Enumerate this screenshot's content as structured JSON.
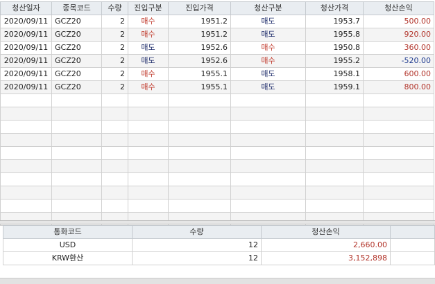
{
  "trades": {
    "headers": [
      "청산일자",
      "종목코드",
      "수량",
      "진입구분",
      "진입가격",
      "청산구분",
      "청산가격",
      "청산손익"
    ],
    "rows": [
      {
        "date": "2020/09/11",
        "code": "GCZ20",
        "qty": "2",
        "entry_side": "매수",
        "entry_price": "1951.2",
        "exit_side": "매도",
        "exit_price": "1953.7",
        "pnl": "500.00"
      },
      {
        "date": "2020/09/11",
        "code": "GCZ20",
        "qty": "2",
        "entry_side": "매수",
        "entry_price": "1951.2",
        "exit_side": "매도",
        "exit_price": "1955.8",
        "pnl": "920.00"
      },
      {
        "date": "2020/09/11",
        "code": "GCZ20",
        "qty": "2",
        "entry_side": "매도",
        "entry_price": "1952.6",
        "exit_side": "매수",
        "exit_price": "1950.8",
        "pnl": "360.00"
      },
      {
        "date": "2020/09/11",
        "code": "GCZ20",
        "qty": "2",
        "entry_side": "매도",
        "entry_price": "1952.6",
        "exit_side": "매수",
        "exit_price": "1955.2",
        "pnl": "-520.00"
      },
      {
        "date": "2020/09/11",
        "code": "GCZ20",
        "qty": "2",
        "entry_side": "매수",
        "entry_price": "1955.1",
        "exit_side": "매도",
        "exit_price": "1958.1",
        "pnl": "600.00"
      },
      {
        "date": "2020/09/11",
        "code": "GCZ20",
        "qty": "2",
        "entry_side": "매수",
        "entry_price": "1955.1",
        "exit_side": "매도",
        "exit_price": "1959.1",
        "pnl": "800.00"
      }
    ]
  },
  "summary": {
    "headers": [
      "통화코드",
      "수량",
      "청산손익"
    ],
    "rows": [
      {
        "currency": "USD",
        "qty": "12",
        "pnl": "2,660.00"
      },
      {
        "currency": "KRW환산",
        "qty": "12",
        "pnl": "3,152,898"
      }
    ]
  },
  "colors": {
    "buy": "#c0392b",
    "sell": "#1f2d6b",
    "profit": "#b2342a",
    "loss": "#1f3b8f",
    "header_bg": "#e9edf1"
  }
}
